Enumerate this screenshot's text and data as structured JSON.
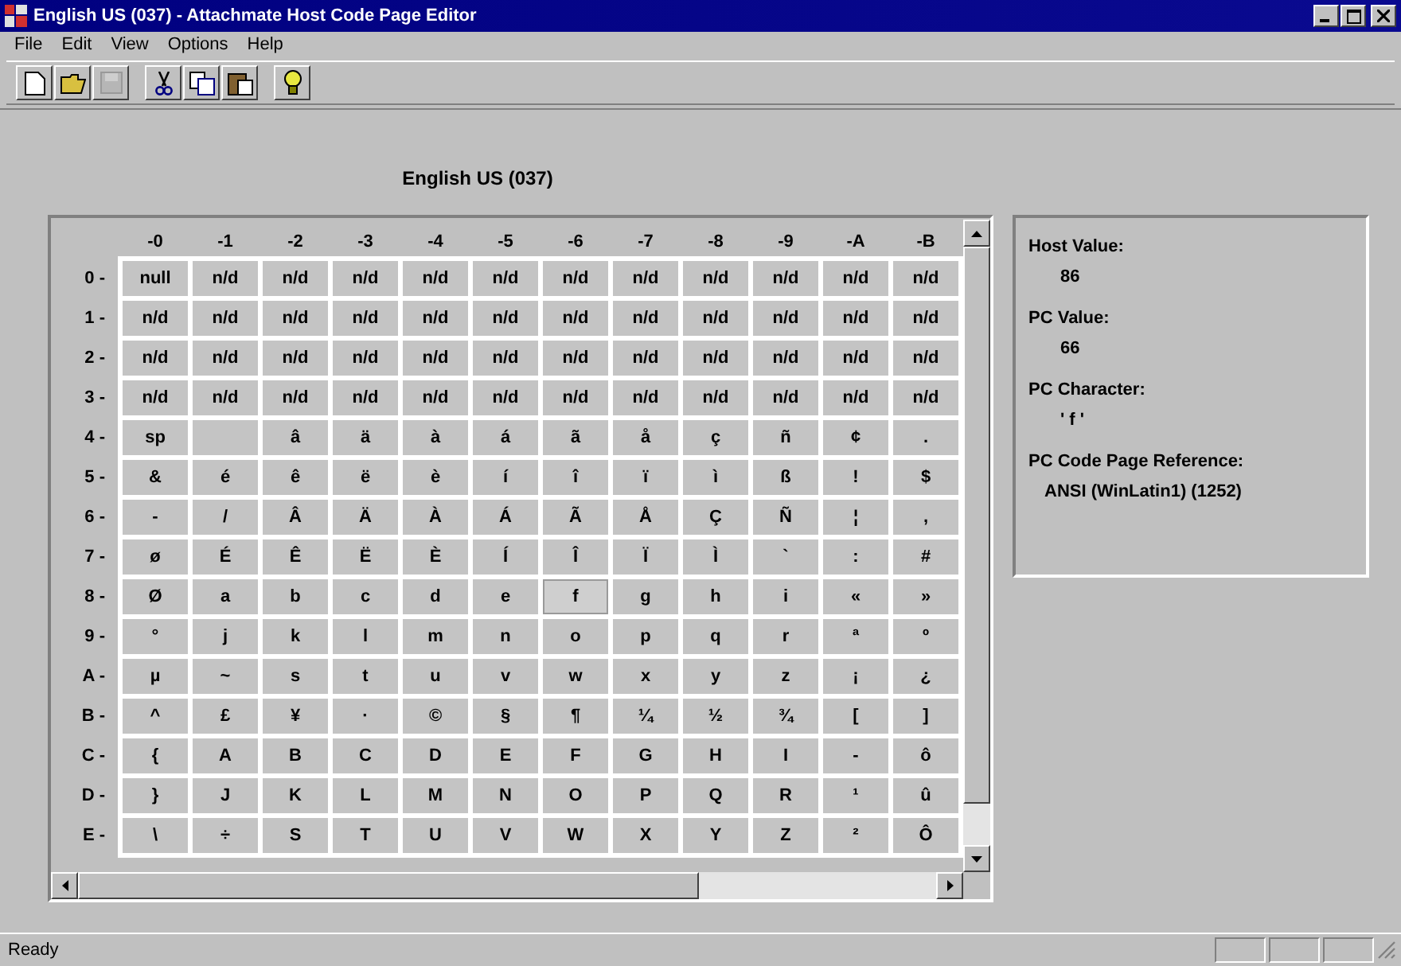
{
  "window": {
    "title": "English US (037) - Attachmate Host Code Page Editor"
  },
  "menu": [
    "File",
    "Edit",
    "View",
    "Options",
    "Help"
  ],
  "toolbar": [
    {
      "kind": "new",
      "disabled": false
    },
    {
      "kind": "open",
      "disabled": false
    },
    {
      "kind": "save",
      "disabled": true
    },
    {
      "kind": "cut",
      "disabled": false
    },
    {
      "kind": "copy",
      "disabled": false
    },
    {
      "kind": "paste",
      "disabled": false
    },
    {
      "kind": "help",
      "disabled": false
    }
  ],
  "heading": "English US (037)",
  "table": {
    "columns": [
      "-0",
      "-1",
      "-2",
      "-3",
      "-4",
      "-5",
      "-6",
      "-7",
      "-8",
      "-9",
      "-A",
      "-B"
    ],
    "rows": [
      {
        "label": "0 -",
        "cells": [
          {
            "text": "null",
            "selected": false
          },
          {
            "text": "n/d",
            "selected": false
          },
          {
            "text": "n/d",
            "selected": false
          },
          {
            "text": "n/d",
            "selected": false
          },
          {
            "text": "n/d",
            "selected": false
          },
          {
            "text": "n/d",
            "selected": false
          },
          {
            "text": "n/d",
            "selected": false
          },
          {
            "text": "n/d",
            "selected": false
          },
          {
            "text": "n/d",
            "selected": false
          },
          {
            "text": "n/d",
            "selected": false
          },
          {
            "text": "n/d",
            "selected": false
          },
          {
            "text": "n/d",
            "selected": false
          }
        ]
      },
      {
        "label": "1 -",
        "cells": [
          {
            "text": "n/d",
            "selected": false
          },
          {
            "text": "n/d",
            "selected": false
          },
          {
            "text": "n/d",
            "selected": false
          },
          {
            "text": "n/d",
            "selected": false
          },
          {
            "text": "n/d",
            "selected": false
          },
          {
            "text": "n/d",
            "selected": false
          },
          {
            "text": "n/d",
            "selected": false
          },
          {
            "text": "n/d",
            "selected": false
          },
          {
            "text": "n/d",
            "selected": false
          },
          {
            "text": "n/d",
            "selected": false
          },
          {
            "text": "n/d",
            "selected": false
          },
          {
            "text": "n/d",
            "selected": false
          }
        ]
      },
      {
        "label": "2 -",
        "cells": [
          {
            "text": "n/d",
            "selected": false
          },
          {
            "text": "n/d",
            "selected": false
          },
          {
            "text": "n/d",
            "selected": false
          },
          {
            "text": "n/d",
            "selected": false
          },
          {
            "text": "n/d",
            "selected": false
          },
          {
            "text": "n/d",
            "selected": false
          },
          {
            "text": "n/d",
            "selected": false
          },
          {
            "text": "n/d",
            "selected": false
          },
          {
            "text": "n/d",
            "selected": false
          },
          {
            "text": "n/d",
            "selected": false
          },
          {
            "text": "n/d",
            "selected": false
          },
          {
            "text": "n/d",
            "selected": false
          }
        ]
      },
      {
        "label": "3 -",
        "cells": [
          {
            "text": "n/d",
            "selected": false
          },
          {
            "text": "n/d",
            "selected": false
          },
          {
            "text": "n/d",
            "selected": false
          },
          {
            "text": "n/d",
            "selected": false
          },
          {
            "text": "n/d",
            "selected": false
          },
          {
            "text": "n/d",
            "selected": false
          },
          {
            "text": "n/d",
            "selected": false
          },
          {
            "text": "n/d",
            "selected": false
          },
          {
            "text": "n/d",
            "selected": false
          },
          {
            "text": "n/d",
            "selected": false
          },
          {
            "text": "n/d",
            "selected": false
          },
          {
            "text": "n/d",
            "selected": false
          }
        ]
      },
      {
        "label": "4 -",
        "cells": [
          {
            "text": "sp",
            "selected": false
          },
          {
            "selected": false
          },
          {
            "text": "â",
            "selected": false
          },
          {
            "text": "ä",
            "selected": false
          },
          {
            "text": "à",
            "selected": false
          },
          {
            "text": "á",
            "selected": false
          },
          {
            "text": "ã",
            "selected": false
          },
          {
            "text": "å",
            "selected": false
          },
          {
            "text": "ç",
            "selected": false
          },
          {
            "text": "ñ",
            "selected": false
          },
          {
            "text": "¢",
            "selected": false
          },
          {
            "text": ".",
            "selected": false
          }
        ]
      },
      {
        "label": "5 -",
        "cells": [
          {
            "text": "&",
            "selected": false
          },
          {
            "text": "é",
            "selected": false
          },
          {
            "text": "ê",
            "selected": false
          },
          {
            "text": "ë",
            "selected": false
          },
          {
            "text": "è",
            "selected": false
          },
          {
            "text": "í",
            "selected": false
          },
          {
            "text": "î",
            "selected": false
          },
          {
            "text": "ï",
            "selected": false
          },
          {
            "text": "ì",
            "selected": false
          },
          {
            "text": "ß",
            "selected": false
          },
          {
            "text": "!",
            "selected": false
          },
          {
            "text": "$",
            "selected": false
          }
        ]
      },
      {
        "label": "6 -",
        "cells": [
          {
            "text": "-",
            "selected": false
          },
          {
            "text": "/",
            "selected": false
          },
          {
            "text": "Â",
            "selected": false
          },
          {
            "text": "Ä",
            "selected": false
          },
          {
            "text": "À",
            "selected": false
          },
          {
            "text": "Á",
            "selected": false
          },
          {
            "text": "Ã",
            "selected": false
          },
          {
            "text": "Å",
            "selected": false
          },
          {
            "text": "Ç",
            "selected": false
          },
          {
            "text": "Ñ",
            "selected": false
          },
          {
            "text": "¦",
            "selected": false
          },
          {
            "text": ",",
            "selected": false
          }
        ]
      },
      {
        "label": "7 -",
        "cells": [
          {
            "text": "ø",
            "selected": false
          },
          {
            "text": "É",
            "selected": false
          },
          {
            "text": "Ê",
            "selected": false
          },
          {
            "text": "Ë",
            "selected": false
          },
          {
            "text": "È",
            "selected": false
          },
          {
            "text": "Í",
            "selected": false
          },
          {
            "text": "Î",
            "selected": false
          },
          {
            "text": "Ï",
            "selected": false
          },
          {
            "text": "Ì",
            "selected": false
          },
          {
            "text": "`",
            "selected": false
          },
          {
            "text": ":",
            "selected": false
          },
          {
            "text": "#",
            "selected": false
          }
        ]
      },
      {
        "label": "8 -",
        "cells": [
          {
            "text": "Ø",
            "selected": false
          },
          {
            "text": "a",
            "selected": false
          },
          {
            "text": "b",
            "selected": false
          },
          {
            "text": "c",
            "selected": false
          },
          {
            "text": "d",
            "selected": false
          },
          {
            "text": "e",
            "selected": false
          },
          {
            "text": "f",
            "selected": true
          },
          {
            "text": "g",
            "selected": false
          },
          {
            "text": "h",
            "selected": false
          },
          {
            "text": "i",
            "selected": false
          },
          {
            "text": "«",
            "selected": false
          },
          {
            "text": "»",
            "selected": false
          }
        ]
      },
      {
        "label": "9 -",
        "cells": [
          {
            "text": "°",
            "selected": false
          },
          {
            "text": "j",
            "selected": false
          },
          {
            "text": "k",
            "selected": false
          },
          {
            "text": "l",
            "selected": false
          },
          {
            "text": "m",
            "selected": false
          },
          {
            "text": "n",
            "selected": false
          },
          {
            "text": "o",
            "selected": false
          },
          {
            "text": "p",
            "selected": false
          },
          {
            "text": "q",
            "selected": false
          },
          {
            "text": "r",
            "selected": false
          },
          {
            "text": "ª",
            "selected": false
          },
          {
            "text": "º",
            "selected": false
          }
        ]
      },
      {
        "label": "A -",
        "cells": [
          {
            "text": "µ",
            "selected": false
          },
          {
            "text": "~",
            "selected": false
          },
          {
            "text": "s",
            "selected": false
          },
          {
            "text": "t",
            "selected": false
          },
          {
            "text": "u",
            "selected": false
          },
          {
            "text": "v",
            "selected": false
          },
          {
            "text": "w",
            "selected": false
          },
          {
            "text": "x",
            "selected": false
          },
          {
            "text": "y",
            "selected": false
          },
          {
            "text": "z",
            "selected": false
          },
          {
            "text": "¡",
            "selected": false
          },
          {
            "text": "¿",
            "selected": false
          }
        ]
      },
      {
        "label": "B -",
        "cells": [
          {
            "text": "^",
            "selected": false
          },
          {
            "text": "£",
            "selected": false
          },
          {
            "text": "¥",
            "selected": false
          },
          {
            "text": "·",
            "selected": false
          },
          {
            "text": "©",
            "selected": false
          },
          {
            "text": "§",
            "selected": false
          },
          {
            "text": "¶",
            "selected": false
          },
          {
            "text": "¼",
            "selected": false
          },
          {
            "text": "½",
            "selected": false
          },
          {
            "text": "¾",
            "selected": false
          },
          {
            "text": "[",
            "selected": false
          },
          {
            "text": "]",
            "selected": false
          }
        ]
      },
      {
        "label": "C -",
        "cells": [
          {
            "text": "{",
            "selected": false
          },
          {
            "text": "A",
            "selected": false
          },
          {
            "text": "B",
            "selected": false
          },
          {
            "text": "C",
            "selected": false
          },
          {
            "text": "D",
            "selected": false
          },
          {
            "text": "E",
            "selected": false
          },
          {
            "text": "F",
            "selected": false
          },
          {
            "text": "G",
            "selected": false
          },
          {
            "text": "H",
            "selected": false
          },
          {
            "text": "I",
            "selected": false
          },
          {
            "text": "-",
            "selected": false
          },
          {
            "text": "ô",
            "selected": false
          }
        ]
      },
      {
        "label": "D -",
        "cells": [
          {
            "text": "}",
            "selected": false
          },
          {
            "text": "J",
            "selected": false
          },
          {
            "text": "K",
            "selected": false
          },
          {
            "text": "L",
            "selected": false
          },
          {
            "text": "M",
            "selected": false
          },
          {
            "text": "N",
            "selected": false
          },
          {
            "text": "O",
            "selected": false
          },
          {
            "text": "P",
            "selected": false
          },
          {
            "text": "Q",
            "selected": false
          },
          {
            "text": "R",
            "selected": false
          },
          {
            "text": "¹",
            "selected": false
          },
          {
            "text": "û",
            "selected": false
          }
        ]
      },
      {
        "label": "E -",
        "cells": [
          {
            "text": "\\",
            "selected": false
          },
          {
            "text": "÷",
            "selected": false
          },
          {
            "text": "S",
            "selected": false
          },
          {
            "text": "T",
            "selected": false
          },
          {
            "text": "U",
            "selected": false
          },
          {
            "text": "V",
            "selected": false
          },
          {
            "text": "W",
            "selected": false
          },
          {
            "text": "X",
            "selected": false
          },
          {
            "text": "Y",
            "selected": false
          },
          {
            "text": "Z",
            "selected": false
          },
          {
            "text": "²",
            "selected": false
          },
          {
            "text": "Ô",
            "selected": false
          }
        ]
      }
    ]
  },
  "details": [
    {
      "label": "Host Value:",
      "value": "86"
    },
    {
      "label": "PC Value:",
      "value": "66"
    },
    {
      "label": "PC Character:",
      "value": "' f '"
    },
    {
      "label": "PC Code Page Reference:",
      "value": "ANSI (WinLatin1) (1252)"
    }
  ],
  "status_bar": {
    "text": "Ready"
  }
}
